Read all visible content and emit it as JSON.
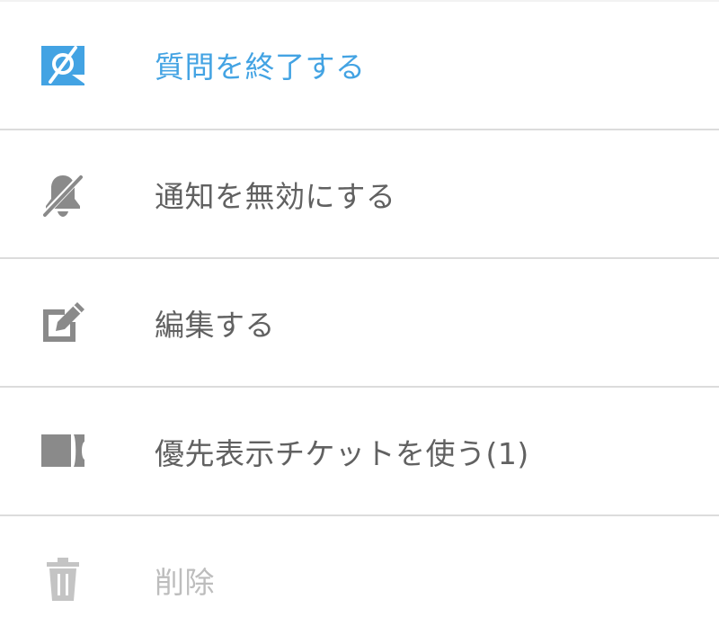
{
  "colors": {
    "accent": "#43a3e3",
    "text": "#616161",
    "icon": "#8a8a8a",
    "disabled": "#c4c4c4",
    "divider": "#dcdcdc"
  },
  "menu": {
    "items": [
      {
        "label": "質問を終了する",
        "icon": "speech-bubble-slash-icon",
        "state": "accent"
      },
      {
        "label": "通知を無効にする",
        "icon": "bell-off-icon",
        "state": "normal"
      },
      {
        "label": "編集する",
        "icon": "edit-icon",
        "state": "normal"
      },
      {
        "label": "優先表示チケットを使う(1)",
        "icon": "ticket-icon",
        "state": "normal"
      },
      {
        "label": "削除",
        "icon": "trash-icon",
        "state": "disabled"
      }
    ]
  }
}
